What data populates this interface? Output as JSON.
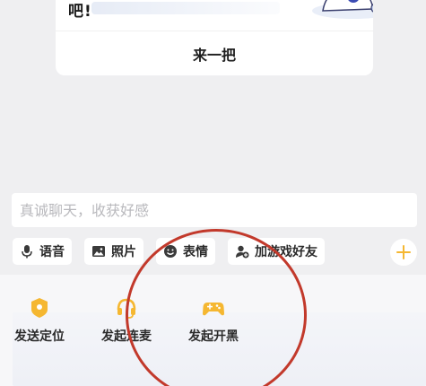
{
  "card": {
    "text": "吧!",
    "button_label": "来一把"
  },
  "input": {
    "placeholder": "真诚聊天，收获好感"
  },
  "toolbar": {
    "items": [
      {
        "label": "语音",
        "icon": "microphone-icon"
      },
      {
        "label": "照片",
        "icon": "image-icon"
      },
      {
        "label": "表情",
        "icon": "emoji-icon"
      },
      {
        "label": "加游戏好友",
        "icon": "add-friend-icon"
      }
    ],
    "more_icon": "plus-icon"
  },
  "actions": [
    {
      "label": "发送定位",
      "icon": "location-icon"
    },
    {
      "label": "发起连麦",
      "icon": "headset-icon"
    },
    {
      "label": "发起开黑",
      "icon": "gamepad-icon"
    }
  ],
  "colors": {
    "accent": "#f5b731",
    "annotation": "#c2392b",
    "background": "#efeff1"
  }
}
